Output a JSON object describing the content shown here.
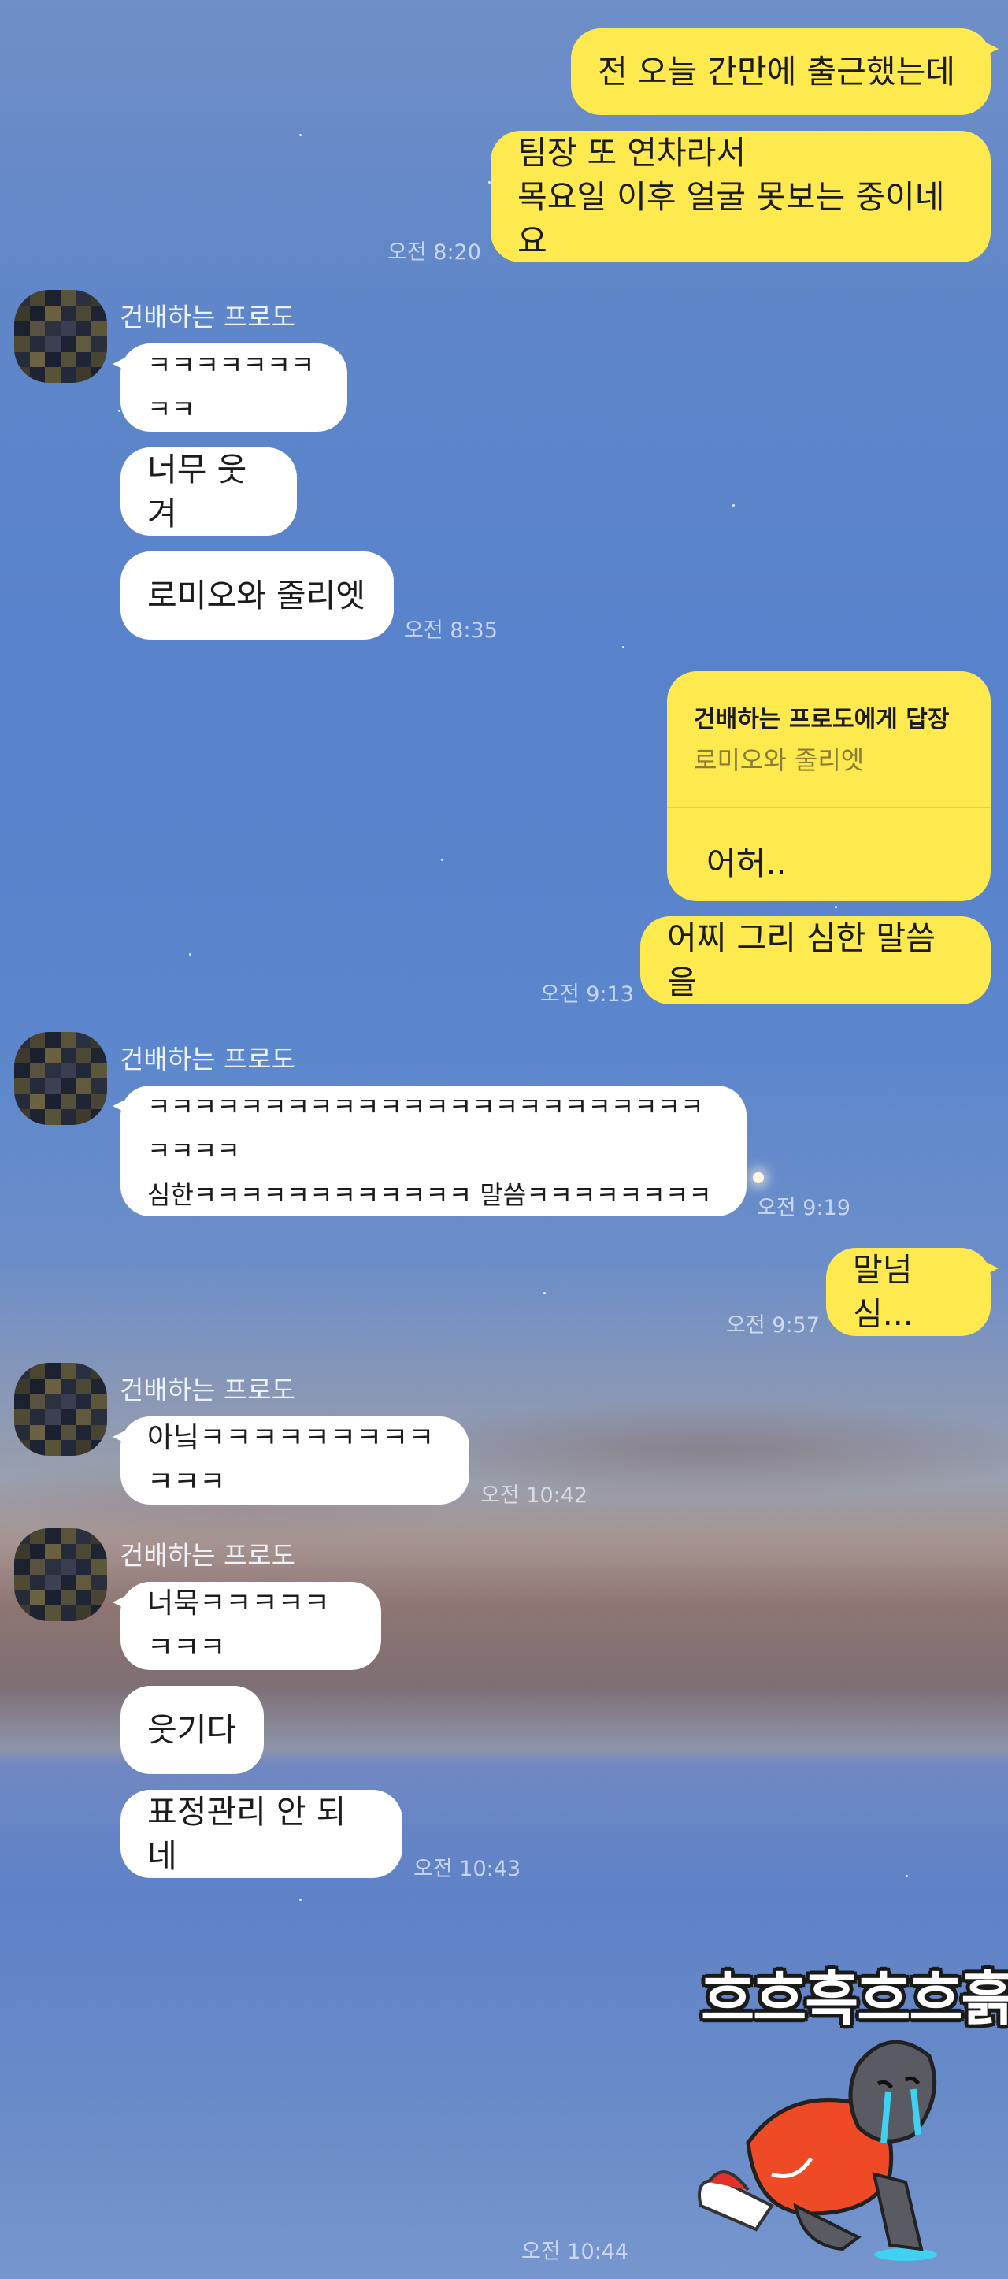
{
  "chat": {
    "sender_name": "건배하는 프로도",
    "messages": {
      "m1": "전 오늘 간만에 출근했는데",
      "m2": "팀장 또 연차라서\n목요일 이후 얼굴 못보는 중이네요",
      "t1": "오전 8:20",
      "m3": "ㅋㅋㅋㅋㅋㅋㅋㅋㅋ",
      "m4": "너무 웃겨",
      "m5": "로미오와 줄리엣",
      "t2": "오전 8:35",
      "reply_header": "건배하는 프로도에게 답장",
      "reply_quote": "로미오와 줄리엣",
      "reply_body": "어허..",
      "m6": "어찌 그리 심한 말씀을",
      "t3": "오전 9:13",
      "m7": "ㅋㅋㅋㅋㅋㅋㅋㅋㅋㅋㅋㅋㅋㅋㅋㅋㅋㅋㅋㅋㅋㅋㅋㅋㅋㅋㅋㅋ\n심한ㅋㅋㅋㅋㅋㅋㅋㅋㅋㅋㅋㅋ 말씀ㅋㅋㅋㅋㅋㅋㅋㅋ",
      "t4": "오전 9:19",
      "m8": "말넘심...",
      "t5": "오전 9:57",
      "m9": "아닠ㅋㅋㅋㅋㅋㅋㅋㅋㅋㅋㅋㅋ",
      "t6": "오전 10:42",
      "m10": "너묵ㅋㅋㅋㅋㅋㅋㅋㅋ",
      "m11": "웃기다",
      "m12": "표정관리 안 되네",
      "t7": "오전 10:43",
      "sticker_text": "흐흐흑흐흐흙",
      "t8": "오전 10:44"
    }
  },
  "colors": {
    "outgoing_bubble": "#fee94e",
    "incoming_bubble": "#ffffff"
  },
  "icons": {
    "avatar": "pixelated-avatar-icon",
    "sticker": "crying-seal-sticker-icon"
  }
}
